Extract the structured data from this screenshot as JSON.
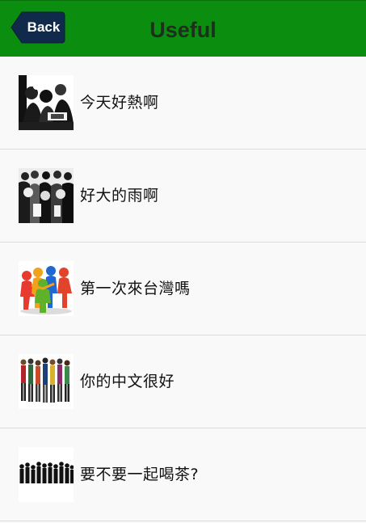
{
  "header": {
    "back_label": "Back",
    "title": "Useful",
    "bar_color": "#0b8e10",
    "back_color": "#0f2a4a"
  },
  "phrases": [
    {
      "text": "今天好熱啊",
      "thumbnail": "crowd-photo-bw"
    },
    {
      "text": "好大的雨啊",
      "thumbnail": "crowd-photo-bw-dense"
    },
    {
      "text": "第一次來台灣嗎",
      "thumbnail": "colorful-people-figures"
    },
    {
      "text": "你的中文很好",
      "thumbnail": "group-people-color"
    },
    {
      "text": "要不要一起喝茶?",
      "thumbnail": "silhouettes-crowd"
    }
  ]
}
